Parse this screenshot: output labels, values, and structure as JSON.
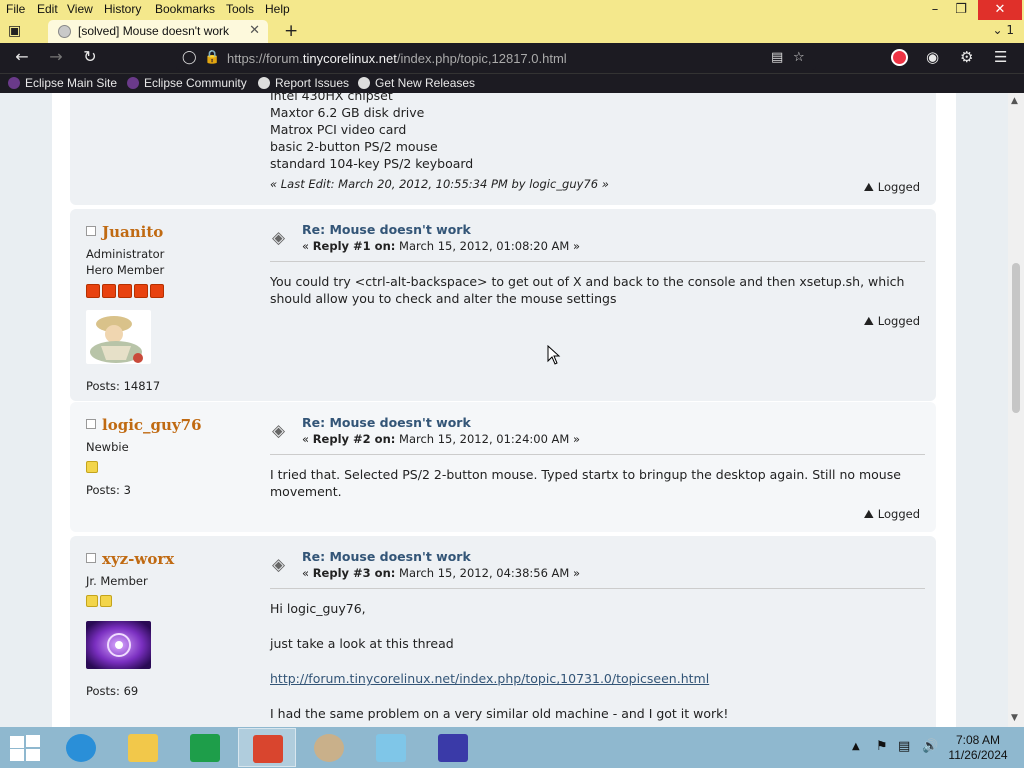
{
  "menu": [
    "File",
    "Edit",
    "View",
    "History",
    "Bookmarks",
    "Tools",
    "Help"
  ],
  "tab": {
    "title": "[solved] Mouse doesn't work"
  },
  "url": {
    "prefix": "https://forum.",
    "host": "tinycorelinux.net",
    "path": "/index.php/topic,12817.0.html"
  },
  "bookmarks": [
    {
      "label": "Eclipse Main Site",
      "color": "#6a3a8a"
    },
    {
      "label": "Eclipse Community",
      "color": "#6a3a8a"
    },
    {
      "label": "Report Issues",
      "color": "#dddddd"
    },
    {
      "label": "Get New Releases",
      "color": "#dddddd"
    }
  ],
  "post0": {
    "lines": [
      "Intel 430HX chipset",
      "Maxtor 6.2 GB disk drive",
      "Matrox PCI video card",
      "basic 2-button PS/2 mouse",
      "standard 104-key PS/2 keyboard"
    ],
    "last_edit": "« Last Edit: March 20, 2012, 10:55:34 PM by logic_guy76 »",
    "logged": "Logged"
  },
  "posts": [
    {
      "name": "Juanito",
      "roles": [
        "Administrator",
        "Hero Member"
      ],
      "posts_count": "Posts: 14817",
      "subject": "Re: Mouse doesn't work",
      "reply_label": "Reply #1 on:",
      "date": "March 15, 2012, 01:08:20 AM »",
      "body": "You could try <ctrl-alt-backspace> to get out of X and back to the console and then xsetup.sh, which should allow you to check and alter the mouse settings",
      "logged": "Logged",
      "stars": 5,
      "star_color": "red"
    },
    {
      "name": "logic_guy76",
      "roles": [
        "Newbie"
      ],
      "posts_count": "Posts: 3",
      "subject": "Re: Mouse doesn't work",
      "reply_label": "Reply #2 on:",
      "date": "March 15, 2012, 01:24:00 AM »",
      "body": "I tried that.  Selected PS/2 2-button mouse.  Typed startx to bringup the desktop again.  Still no mouse movement.",
      "logged": "Logged",
      "stars": 1,
      "star_color": "yellow"
    },
    {
      "name": "xyz-worx",
      "roles": [
        "Jr. Member"
      ],
      "posts_count": "Posts: 69",
      "subject": "Re: Mouse doesn't work",
      "reply_label": "Reply #3 on:",
      "date": "March 15, 2012, 04:38:56 AM »",
      "body_lines": [
        "Hi logic_guy76,",
        "just take a look at this thread",
        "http://forum.tinycorelinux.net/index.php/topic,10731.0/topicseen.html",
        "I had the same problem on a very similar old machine - and I got it work!"
      ],
      "stars": 2,
      "star_color": "yellow"
    }
  ],
  "clock": {
    "time": "7:08 AM",
    "date": "11/26/2024"
  },
  "colors": {
    "tab_bar": "#f4e88c",
    "nav_bar": "#1c1b22",
    "poster_name": "#c06a12",
    "subject": "#335577"
  }
}
